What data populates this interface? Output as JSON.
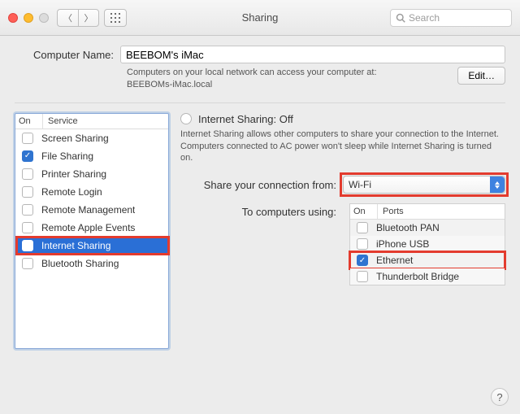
{
  "window": {
    "title": "Sharing",
    "search_placeholder": "Search"
  },
  "computer_name": {
    "label": "Computer Name:",
    "value": "BEEBOM's iMac",
    "hint_line1": "Computers on your local network can access your computer at:",
    "hint_line2": "BEEBOMs-iMac.local",
    "edit_label": "Edit…"
  },
  "services": {
    "header_on": "On",
    "header_service": "Service",
    "items": [
      {
        "label": "Screen Sharing",
        "checked": false,
        "selected": false
      },
      {
        "label": "File Sharing",
        "checked": true,
        "selected": false
      },
      {
        "label": "Printer Sharing",
        "checked": false,
        "selected": false
      },
      {
        "label": "Remote Login",
        "checked": false,
        "selected": false
      },
      {
        "label": "Remote Management",
        "checked": false,
        "selected": false
      },
      {
        "label": "Remote Apple Events",
        "checked": false,
        "selected": false
      },
      {
        "label": "Internet Sharing",
        "checked": false,
        "selected": true,
        "highlight": true
      },
      {
        "label": "Bluetooth Sharing",
        "checked": false,
        "selected": false
      }
    ]
  },
  "detail": {
    "title": "Internet Sharing: Off",
    "description": "Internet Sharing allows other computers to share your connection to the Internet. Computers connected to AC power won't sleep while Internet Sharing is turned on.",
    "share_from_label": "Share your connection from:",
    "share_from_value": "Wi-Fi",
    "to_label": "To computers using:",
    "ports_header_on": "On",
    "ports_header_ports": "Ports",
    "ports": [
      {
        "label": "Bluetooth PAN",
        "checked": false
      },
      {
        "label": "iPhone USB",
        "checked": false
      },
      {
        "label": "Ethernet",
        "checked": true,
        "highlight": true
      },
      {
        "label": "Thunderbolt Bridge",
        "checked": false
      }
    ]
  },
  "help_label": "?"
}
